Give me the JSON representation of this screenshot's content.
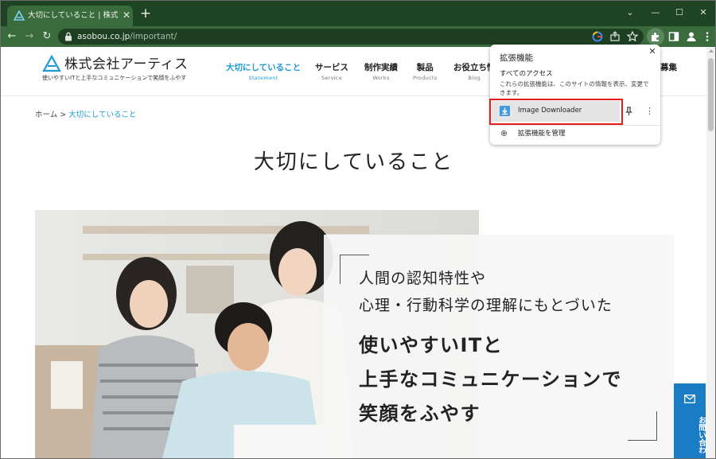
{
  "browser": {
    "tab": {
      "title": "大切にしていること | 株式会社アーティス",
      "close_glyph": "✕"
    },
    "new_tab_glyph": "+",
    "window_controls": {
      "minimize": "—",
      "maximize": "☐",
      "close": "✕",
      "tabs_menu": "⌄"
    },
    "nav": {
      "back": "←",
      "forward": "→",
      "reload": "↻"
    },
    "address": {
      "host": "asobou.co.jp",
      "path": "/important/"
    },
    "colors": {
      "frame": "#1f4423",
      "toolbar": "#3a6b3d",
      "omnibox": "#1e3f22"
    }
  },
  "site": {
    "logo": {
      "name": "株式会社アーティス",
      "tagline": "使いやすいITと上手なコミュニケーションで笑顔をふやす"
    },
    "nav": [
      {
        "jp": "大切にしていること",
        "en": "Statement",
        "active": true
      },
      {
        "jp": "サービス",
        "en": "Service",
        "active": false
      },
      {
        "jp": "制作実績",
        "en": "Works",
        "active": false
      },
      {
        "jp": "製品",
        "en": "Products",
        "active": false
      },
      {
        "jp": "お役立ち情",
        "en": "Blog",
        "active": false
      }
    ],
    "nav_cutoff": "募集",
    "breadcrumb": {
      "home": "ホーム",
      "separator": ">",
      "current": "大切にしていること"
    },
    "page_title": "大切にしていること",
    "message": {
      "line1": "人間の認知特性や",
      "line2": "心理・行動科学の理解にもとづいた",
      "line3": "使いやすいITと",
      "line4": "上手なコミュニケーションで",
      "line5": "笑顔をふやす"
    },
    "contact_button": {
      "label": "お問い合わ",
      "icon": "mail-icon"
    },
    "accent_color": "#1b9ad6"
  },
  "extensions_popup": {
    "title": "拡張機能",
    "close_glyph": "✕",
    "subheading": "すべてのアクセス",
    "description": "これらの拡張機能は、このサイトの情報を表示、変更できます。",
    "extension": {
      "name": "Image Downloader",
      "more_glyph": "⋮"
    },
    "manage_label": "拡張機能を管理"
  }
}
